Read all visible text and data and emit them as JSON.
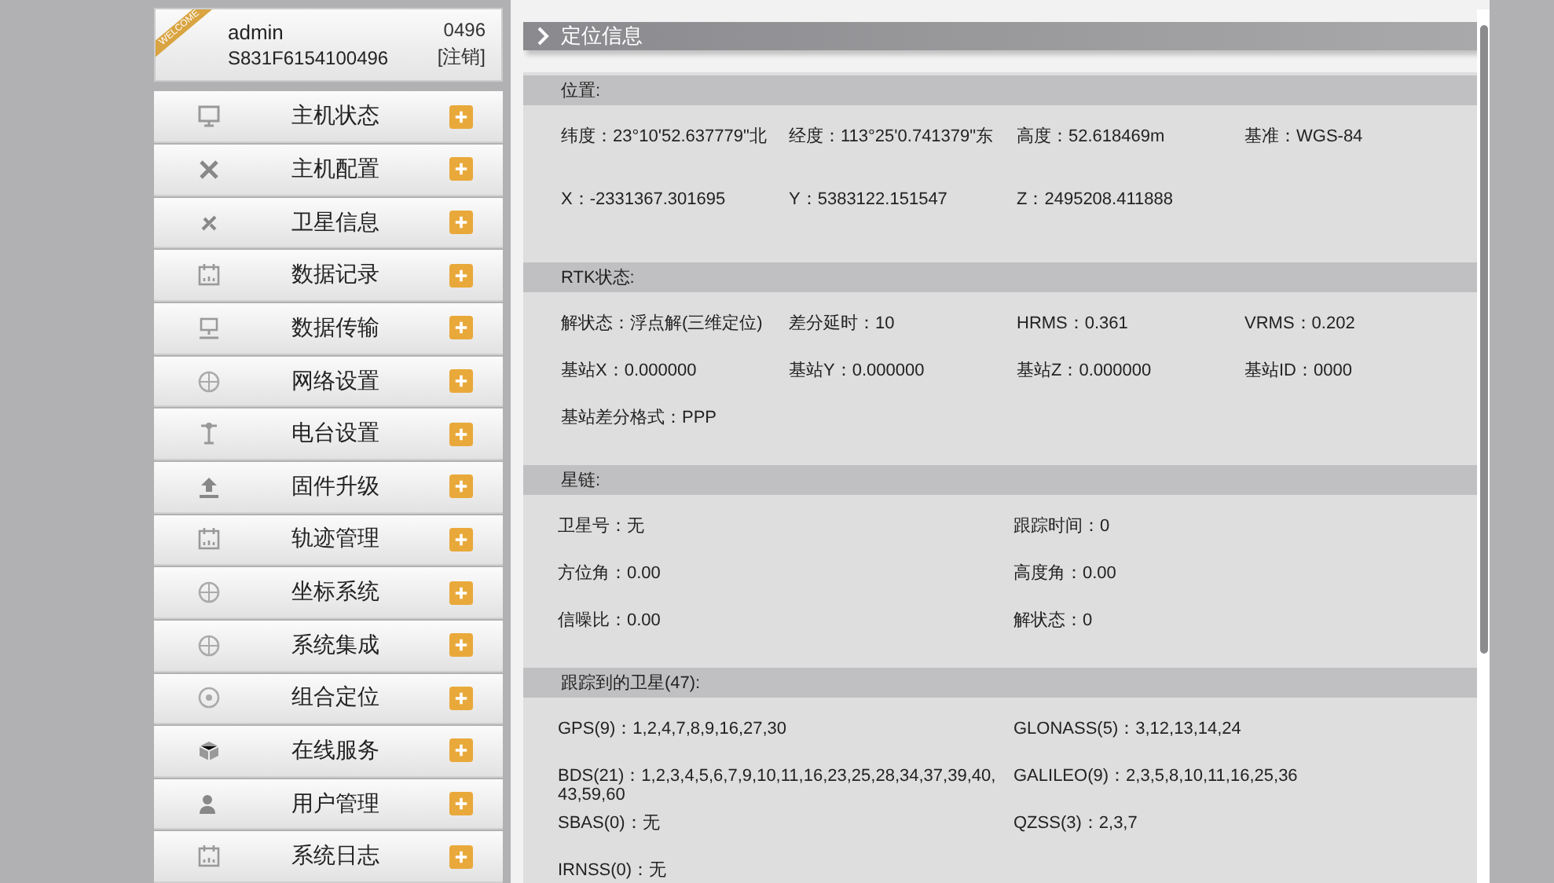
{
  "user_card": {
    "ribbon": "WELCOME",
    "username": "admin",
    "serial": "S831F6154100496",
    "code": "0496",
    "logout": "[注销]"
  },
  "sidebar": {
    "items": [
      {
        "label": "主机状态"
      },
      {
        "label": "主机配置"
      },
      {
        "label": "卫星信息"
      },
      {
        "label": "数据记录"
      },
      {
        "label": "数据传输"
      },
      {
        "label": "网络设置"
      },
      {
        "label": "电台设置"
      },
      {
        "label": "固件升级"
      },
      {
        "label": "轨迹管理"
      },
      {
        "label": "坐标系统"
      },
      {
        "label": "系统集成"
      },
      {
        "label": "组合定位"
      },
      {
        "label": "在线服务"
      },
      {
        "label": "用户管理"
      },
      {
        "label": "系统日志"
      }
    ]
  },
  "panel": {
    "title": "定位信息",
    "sections": [
      {
        "heading": "位置:",
        "kind": "grid4",
        "rows": [
          [
            "纬度：23°10'52.637779\"北",
            "经度：113°25'0.741379\"东",
            "高度：52.618469m",
            "基准：WGS-84"
          ],
          [
            "X：-2331367.301695",
            "Y：5383122.151547",
            "Z：2495208.411888"
          ]
        ]
      },
      {
        "heading": "RTK状态:",
        "kind": "grid4",
        "rows": [
          [
            "解状态：浮点解(三维定位)",
            "差分延时：10",
            "HRMS：0.361",
            "VRMS：0.202"
          ],
          [
            "基站X：0.000000",
            "基站Y：0.000000",
            "基站Z：0.000000",
            "基站ID：0000"
          ],
          [
            "基站差分格式：PPP"
          ]
        ]
      },
      {
        "heading": "星链:",
        "kind": "grid2",
        "rows": [
          [
            "卫星号：无",
            "跟踪时间：0"
          ],
          [
            "方位角：0.00",
            "高度角：0.00"
          ],
          [
            "信噪比：0.00",
            "解状态：0"
          ]
        ]
      },
      {
        "heading": "跟踪到的卫星(47):",
        "kind": "grid2",
        "rows": [
          [
            "GPS(9)：1,2,4,7,8,9,16,27,30",
            "GLONASS(5)：3,12,13,14,24"
          ],
          [
            "BDS(21)：1,2,3,4,5,6,7,9,10,11,16,23,25,28,34,37,39,40,43,59,60",
            "GALILEO(9)：2,3,5,8,10,11,16,25,36"
          ],
          [
            "SBAS(0)：无",
            "QZSS(3)：2,3,7"
          ],
          [
            "IRNSS(0)：无"
          ]
        ]
      }
    ]
  }
}
